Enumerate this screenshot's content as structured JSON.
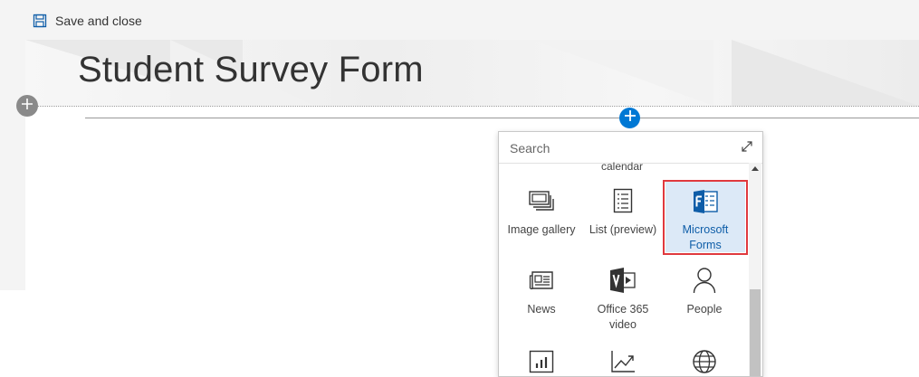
{
  "toolbar": {
    "save_label": "Save and close",
    "save_icon": "save-icon"
  },
  "page": {
    "title": "Student Survey Form"
  },
  "picker": {
    "search_placeholder": "Search",
    "partial_label": "calendar",
    "tiles": [
      {
        "label": "Image gallery",
        "icon": "image-gallery-icon"
      },
      {
        "label": "List (preview)",
        "icon": "list-icon"
      },
      {
        "label": "Microsoft Forms",
        "icon": "microsoft-forms-icon",
        "selected": true
      },
      {
        "label": "News",
        "icon": "news-icon"
      },
      {
        "label": "Office 365 video",
        "icon": "office-365-video-icon"
      },
      {
        "label": "People",
        "icon": "people-icon"
      }
    ]
  },
  "colors": {
    "accent": "#0078d4",
    "selected_bg": "#dce9f7",
    "highlight_border": "#e0393e",
    "forms_brand": "#0e5da8"
  }
}
